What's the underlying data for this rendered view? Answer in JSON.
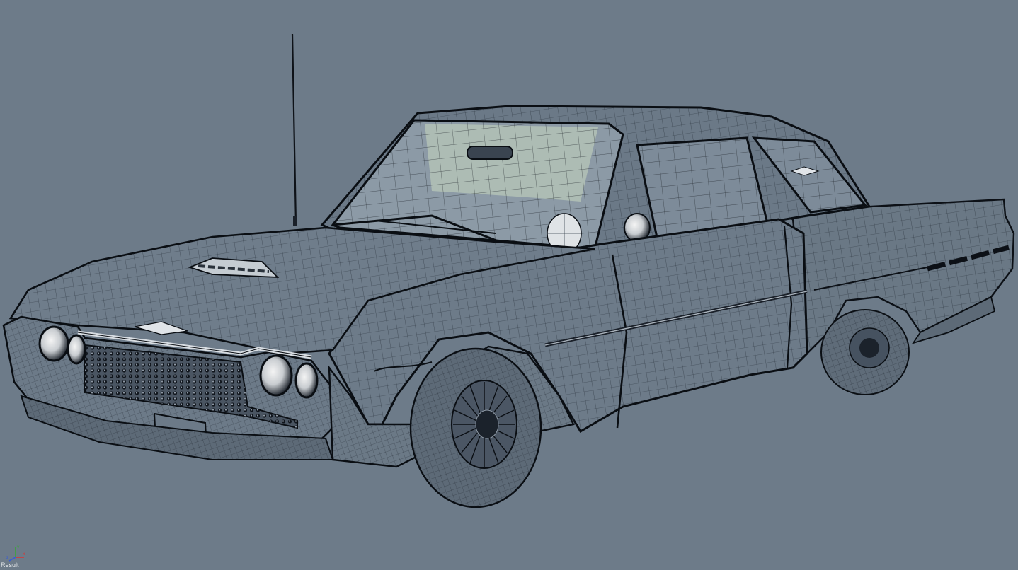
{
  "viewport": {
    "label": "Result",
    "background": "#6d7b89"
  },
  "axis_gizmo": {
    "x_label": "x",
    "y_label": "y",
    "z_label": "z",
    "x_color": "#d23a3a",
    "y_color": "#3aa43a",
    "z_color": "#3a5ed2"
  },
  "model": {
    "icon": "wireframe-car-model",
    "mesh_color": "#0d1117",
    "glass_tint": "#c9d8c0"
  }
}
